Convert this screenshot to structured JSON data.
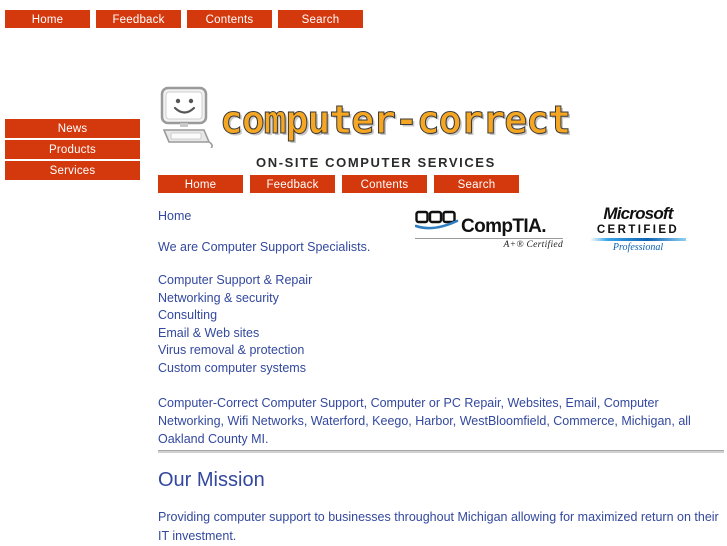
{
  "top_nav": {
    "items": [
      {
        "label": "Home"
      },
      {
        "label": "Feedback"
      },
      {
        "label": "Contents"
      },
      {
        "label": "Search"
      }
    ]
  },
  "sidebar": {
    "items": [
      {
        "label": "News"
      },
      {
        "label": "Products"
      },
      {
        "label": "Services"
      }
    ]
  },
  "logo": {
    "wordmark": "computer-correct",
    "tagline": "ON-SITE COMPUTER SERVICES",
    "icon": "smiley-computer-icon"
  },
  "sub_nav": {
    "items": [
      {
        "label": "Home"
      },
      {
        "label": "Feedback"
      },
      {
        "label": "Contents"
      },
      {
        "label": "Search"
      }
    ]
  },
  "content": {
    "breadcrumb": "Home",
    "intro": "We are Computer Support Specialists.",
    "services": [
      {
        "label": "Computer Support & Repair"
      },
      {
        "label": "Networking & security"
      },
      {
        "label": "Consulting"
      },
      {
        "label": "Email & Web sites"
      },
      {
        "label": "Virus removal & protection"
      },
      {
        "label": "Custom computer systems"
      }
    ],
    "keywords": "Computer-Correct Computer Support, Computer or PC Repair, Websites, Email, Computer Networking, Wifi Networks, Waterford, Keego, Harbor, WestBloomfield, Commerce, Michigan, all Oakland County MI."
  },
  "certifications": {
    "comptia": {
      "name": "CompTIA.",
      "sub": "A+® Certified"
    },
    "microsoft": {
      "name": "Microsoft",
      "certified": "CERTIFIED",
      "level": "Professional"
    }
  },
  "mission": {
    "title": "Our Mission",
    "body": "Providing computer support to businesses throughout Michigan allowing for maximized return on their IT investment."
  },
  "colors": {
    "button": "#d4380d",
    "text": "#33489e",
    "logo_orange": "#f5a623",
    "ms_blue": "#0e63b4"
  }
}
